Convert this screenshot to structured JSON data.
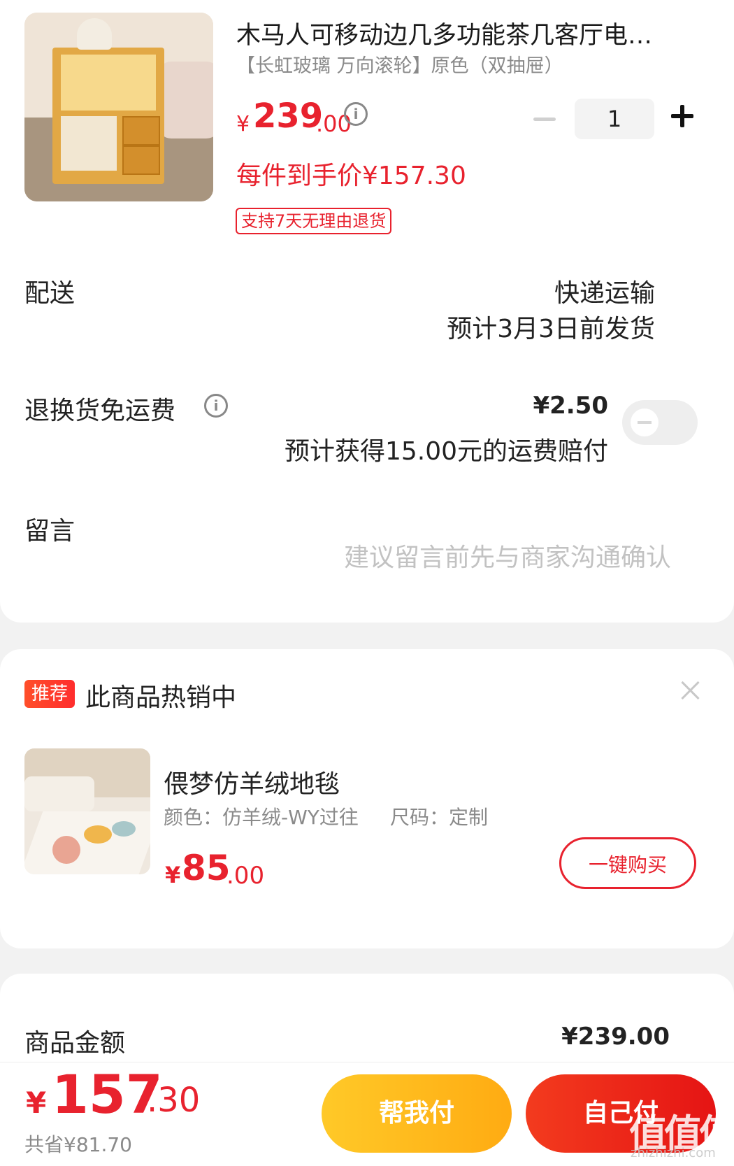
{
  "product": {
    "title": "木马人可移动边几多功能茶几客厅电…",
    "spec": "【长虹玻璃 万向滚轮】原色（双抽屉）",
    "price_symbol": "¥",
    "price_int": "239",
    "price_dec": ".00",
    "quantity": "1",
    "final_price": "每件到手价¥157.30",
    "return_tag": "支持7天无理由退货"
  },
  "delivery": {
    "label": "配送",
    "method": "快递运输",
    "eta": "预计3月3日前发货"
  },
  "return_insurance": {
    "label": "退换货免运费",
    "price": "¥2.50",
    "note": "预计获得15.00元的运费赔付",
    "enabled": false
  },
  "message": {
    "label": "留言",
    "placeholder": "建议留言前先与商家沟通确认"
  },
  "recommend": {
    "badge": "推荐",
    "title": "此商品热销中",
    "item": {
      "name": "偎梦仿羊绒地毯",
      "spec_color": "颜色：仿羊绒-WY过往",
      "spec_size": "尺码：定制",
      "price_symbol": "¥",
      "price_int": "85",
      "price_dec": ".00",
      "buy_label": "一键购买"
    }
  },
  "summary": {
    "label": "商品金额",
    "value": "¥239.00"
  },
  "bottom": {
    "total_symbol": "¥",
    "total_int": "157",
    "total_dec": ".30",
    "saved": "共省¥81.70",
    "help_pay": "帮我付",
    "self_pay": "自己付"
  },
  "watermark": {
    "text": "值值值",
    "url": "zhizhizhi.com"
  },
  "colors": {
    "accent_red": "#e8222e",
    "button_yellow": "#ffbb1f",
    "button_red": "#e8261a"
  }
}
